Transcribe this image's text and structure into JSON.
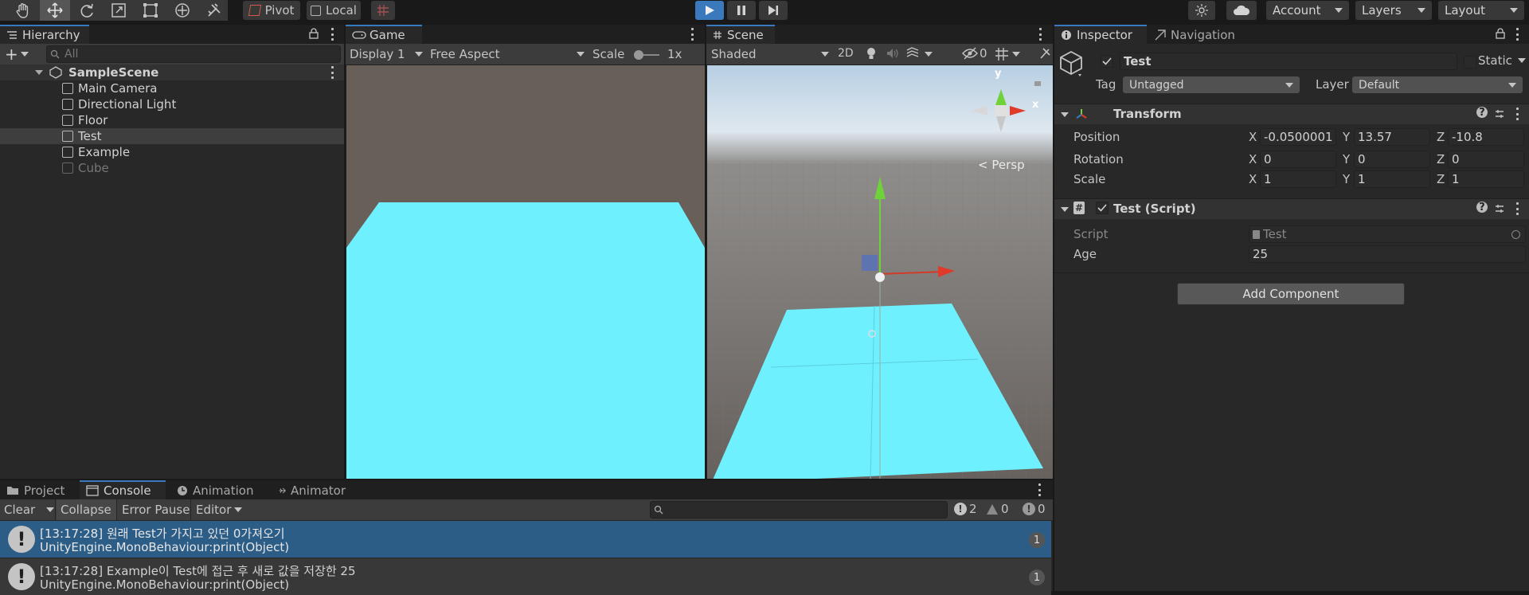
{
  "toolbar": {
    "pivot": "Pivot",
    "local": "Local",
    "account": "Account",
    "layers": "Layers",
    "layout": "Layout"
  },
  "hierarchy": {
    "tab": "Hierarchy",
    "search_placeholder": "All",
    "scene": "SampleScene",
    "items": [
      "Main Camera",
      "Directional Light",
      "Floor",
      "Test",
      "Example",
      "Cube"
    ]
  },
  "game": {
    "tab": "Game",
    "display": "Display 1",
    "aspect": "Free Aspect",
    "scale_label": "Scale",
    "scale_value": "1x"
  },
  "scene": {
    "tab": "Scene",
    "shading": "Shaded",
    "mode2d": "2D",
    "hidden_count": "0",
    "gizmo_y": "y",
    "gizmo_x": "x",
    "persp": "Persp"
  },
  "inspector": {
    "tab": "Inspector",
    "nav_tab": "Navigation",
    "object_name": "Test",
    "static_label": "Static",
    "tag_label": "Tag",
    "tag_value": "Untagged",
    "layer_label": "Layer",
    "layer_value": "Default",
    "transform_title": "Transform",
    "position_label": "Position",
    "rotation_label": "Rotation",
    "scale_label": "Scale",
    "position": {
      "x": "-0.0500001",
      "y": "13.57",
      "z": "-10.8"
    },
    "rotation": {
      "x": "0",
      "y": "0",
      "z": "0"
    },
    "scale": {
      "x": "1",
      "y": "1",
      "z": "1"
    },
    "axis_x": "X",
    "axis_y": "Y",
    "axis_z": "Z",
    "script_title": "Test (Script)",
    "script_label": "Script",
    "script_value": "Test",
    "age_label": "Age",
    "age_value": "25",
    "add_component": "Add Component"
  },
  "bottom": {
    "tabs": [
      "Project",
      "Console",
      "Animation",
      "Animator"
    ],
    "clear": "Clear",
    "collapse": "Collapse",
    "error_pause": "Error Pause",
    "editor": "Editor",
    "log_count": "2",
    "warn_count": "0",
    "error_count": "0",
    "logs": [
      {
        "line1": "[13:17:28] 원래 Test가 가지고 있던 0가져오기",
        "line2": "UnityEngine.MonoBehaviour:print(Object)",
        "count": "1"
      },
      {
        "line1": "[13:17:28] Example이 Test에 접근 후 새로 값을 저장한 25",
        "line2": "UnityEngine.MonoBehaviour:print(Object)",
        "count": "1"
      }
    ]
  },
  "colors": {
    "accent": "#3a79bb",
    "floor": "#6ff0ff",
    "selected_row": "#2c5d87"
  }
}
